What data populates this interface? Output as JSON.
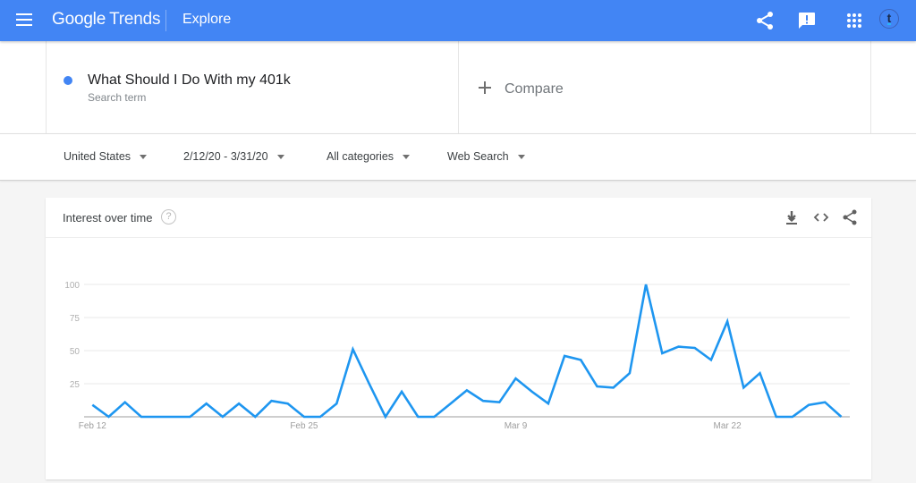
{
  "header": {
    "logo_google": "Google",
    "logo_trends": "Trends",
    "page_name": "Explore",
    "avatar_initial": "t",
    "icons": [
      "menu-icon",
      "share-icon",
      "feedback-icon",
      "apps-icon",
      "account-avatar"
    ],
    "background_color": "#4285f4"
  },
  "search_terms": [
    {
      "term": "What Should I Do With my 401k",
      "sublabel": "Search term",
      "color": "#4285f4"
    }
  ],
  "compare": {
    "label": "Compare",
    "icon": "plus-icon"
  },
  "filters": [
    {
      "label": "United States"
    },
    {
      "label": "2/12/20 - 3/31/20"
    },
    {
      "label": "All categories"
    },
    {
      "label": "Web Search"
    }
  ],
  "card": {
    "title": "Interest over time",
    "help_glyph": "?",
    "actions": [
      "download-icon",
      "embed-icon",
      "share-icon"
    ]
  },
  "chart_data": {
    "type": "line",
    "title": "Interest over time",
    "xlabel": "",
    "ylabel": "",
    "ylim": [
      0,
      100
    ],
    "y_ticks": [
      25,
      50,
      75,
      100
    ],
    "x_tick_labels": [
      "Feb 12",
      "Feb 25",
      "Mar 9",
      "Mar 22"
    ],
    "grid": true,
    "legend": "none",
    "x": [
      "Feb 12",
      "Feb 13",
      "Feb 14",
      "Feb 15",
      "Feb 16",
      "Feb 17",
      "Feb 18",
      "Feb 19",
      "Feb 20",
      "Feb 21",
      "Feb 22",
      "Feb 23",
      "Feb 24",
      "Feb 25",
      "Feb 26",
      "Feb 27",
      "Feb 28",
      "Feb 29",
      "Mar 1",
      "Mar 2",
      "Mar 3",
      "Mar 4",
      "Mar 5",
      "Mar 6",
      "Mar 7",
      "Mar 8",
      "Mar 9",
      "Mar 10",
      "Mar 11",
      "Mar 12",
      "Mar 13",
      "Mar 14",
      "Mar 15",
      "Mar 16",
      "Mar 17",
      "Mar 18",
      "Mar 19",
      "Mar 20",
      "Mar 21",
      "Mar 22",
      "Mar 23",
      "Mar 24",
      "Mar 25",
      "Mar 26",
      "Mar 27",
      "Mar 28",
      "Mar 29"
    ],
    "series": [
      {
        "name": "What Should I Do With my 401k",
        "color": "#1e96f0",
        "values": [
          9,
          0,
          11,
          0,
          0,
          0,
          0,
          10,
          0,
          10,
          0,
          12,
          10,
          0,
          0,
          10,
          51,
          25,
          0,
          19,
          0,
          0,
          10,
          20,
          12,
          11,
          29,
          19,
          10,
          46,
          43,
          23,
          22,
          33,
          100,
          48,
          53,
          52,
          43,
          72,
          22,
          33,
          0,
          0,
          9,
          11,
          0
        ]
      }
    ]
  }
}
